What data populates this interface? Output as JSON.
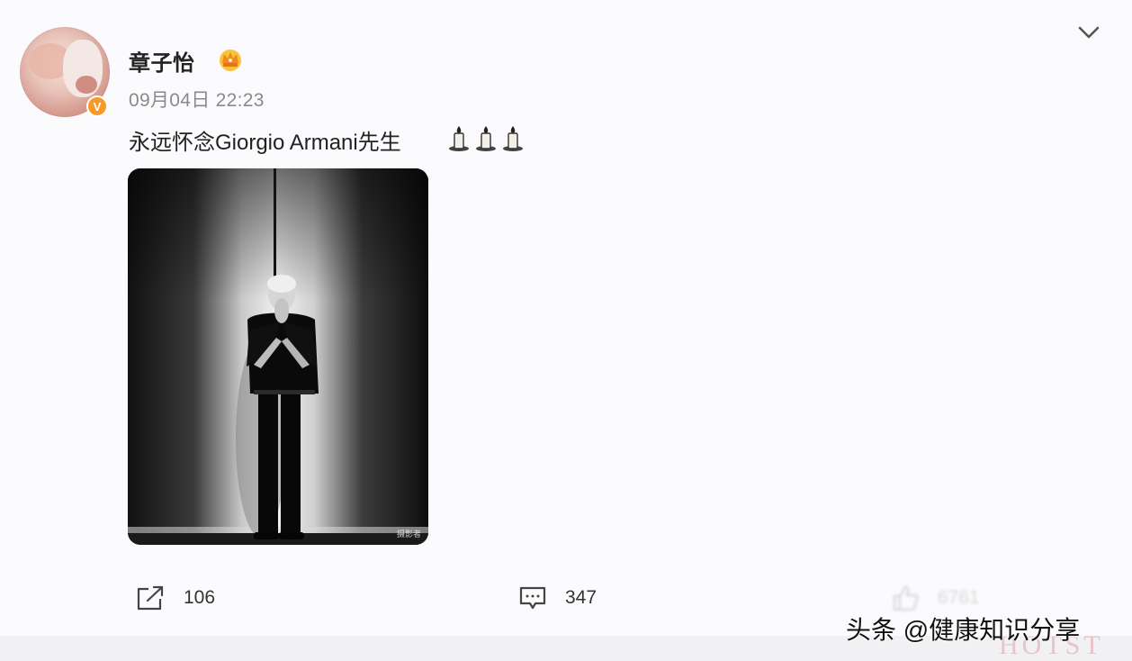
{
  "author": {
    "name": "章子怡",
    "verified_icon": "verified-v-icon",
    "vip_icon": "crown-badge-icon"
  },
  "post": {
    "timestamp": "09月04日 22:23",
    "text": "永远怀念Giorgio Armani先生",
    "emoji": [
      "candle-icon",
      "candle-icon",
      "candle-icon"
    ],
    "image_watermark": "摄影者"
  },
  "actions": {
    "repost_count": "106",
    "comment_count": "347",
    "like_count": "6761"
  },
  "menu_icon": "chevron-down-icon",
  "source_watermark": "头条 @健康知识分享",
  "ghost_text": "HOTST",
  "colors": {
    "verify_badge": "#f79a28",
    "text": "#222222",
    "meta": "#8a8a8a"
  }
}
